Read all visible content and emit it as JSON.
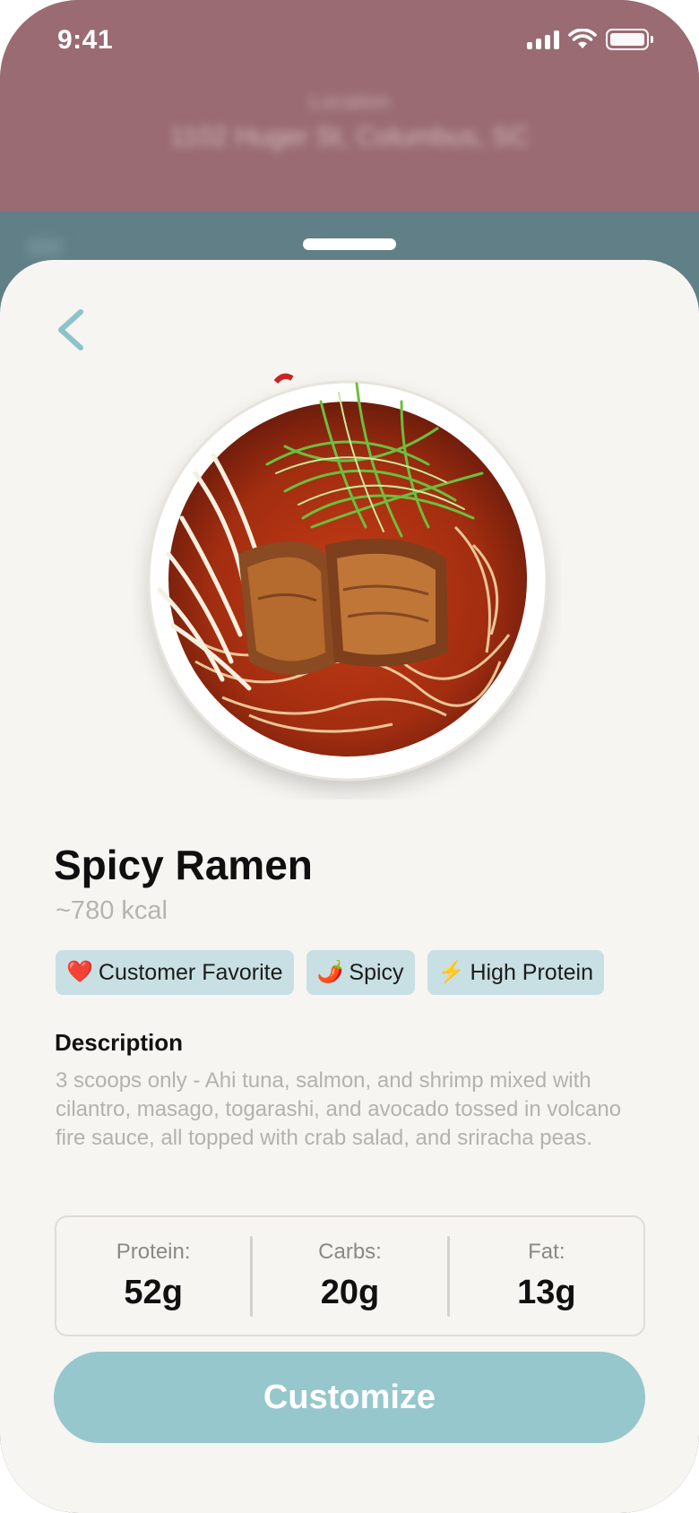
{
  "status_bar": {
    "time": "9:41"
  },
  "background": {
    "location_label": "Location",
    "location_value": "1102 Huger St, Columbus, SC"
  },
  "dish": {
    "name": "Spicy Ramen",
    "calories": "~780 kcal",
    "image_icon": "ramen-bowl-photo",
    "tags": [
      {
        "icon": "heart-icon",
        "glyph": "❤️",
        "label": "Customer Favorite"
      },
      {
        "icon": "chili-pepper-icon",
        "glyph": "🌶️",
        "label": "Spicy"
      },
      {
        "icon": "lightning-icon",
        "glyph": "⚡",
        "label": "High Protein"
      }
    ],
    "description_heading": "Description",
    "description": "3 scoops only - Ahi tuna, salmon, and shrimp mixed with cilantro, masago, togarashi, and avocado tossed in volcano fire sauce, all topped with crab salad, and sriracha peas.",
    "macros": {
      "protein_label": "Protein:",
      "protein_value": "52g",
      "carbs_label": "Carbs:",
      "carbs_value": "20g",
      "fat_label": "Fat:",
      "fat_value": "13g"
    }
  },
  "actions": {
    "customize_label": "Customize"
  },
  "colors": {
    "top_background": "#9a6b73",
    "sheet_background": "#f6f5f1",
    "accent": "#96c7cd",
    "tag_background": "#c8e0e3",
    "back_chevron": "#8cc3cb"
  }
}
